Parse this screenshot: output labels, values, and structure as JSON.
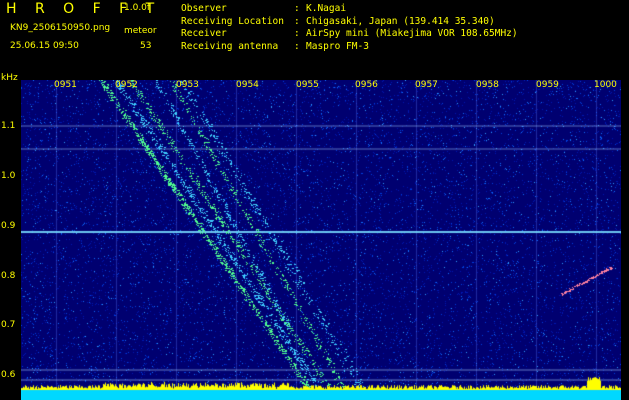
{
  "header": {
    "app_title": "H R O F F T",
    "version": "1.0.0f",
    "filename": "KN9_2506150950.png",
    "meteor_label": "meteor",
    "timestamp": "25.06.15 09:50",
    "meteor_count": "53"
  },
  "info": [
    {
      "key": "Observer",
      "value": "K.Nagai"
    },
    {
      "key": "Receiving Location",
      "value": "Chigasaki, Japan (139.414 35.340)"
    },
    {
      "key": "Receiver",
      "value": "AirSpy mini (Miakejima VOR 108.65MHz)"
    },
    {
      "key": "Receiving antenna",
      "value": "Maspro FM-3"
    }
  ],
  "axis": {
    "y_unit": "kHz",
    "y_ticks": [
      "1.1",
      "1.0",
      "0.9",
      "0.8",
      "0.7",
      "0.6"
    ],
    "x_ticks": [
      "0951",
      "0952",
      "0953",
      "0954",
      "0955",
      "0956",
      "0957",
      "0958",
      "0959",
      "1000"
    ]
  },
  "colors": {
    "background": "#000000",
    "label": "#ffff00",
    "spectrum_base": "#00008c",
    "trail": "#55ff88",
    "carrier": "#7fd0ff",
    "noise_floor": "#00e0ff",
    "noise_peaks": "#ffff00"
  }
}
